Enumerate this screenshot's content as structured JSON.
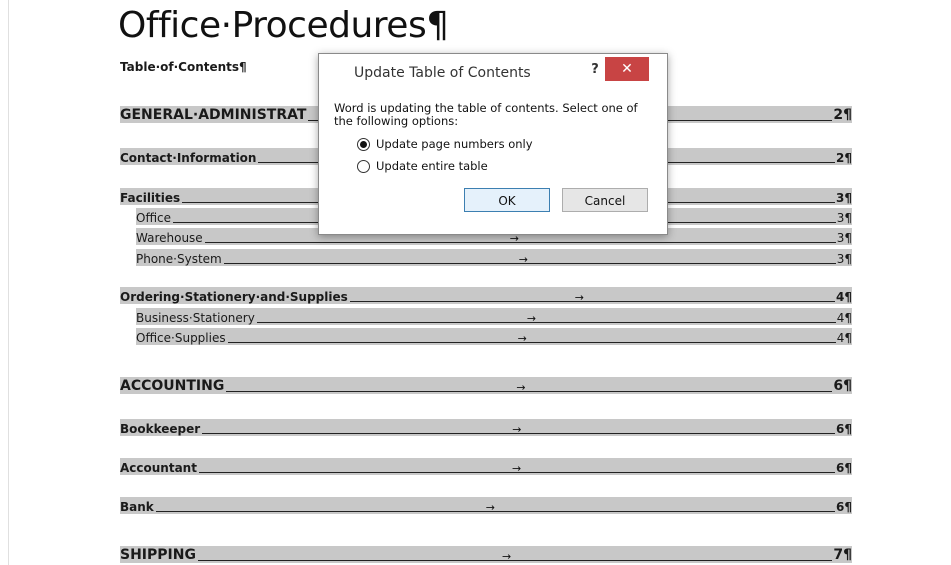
{
  "document": {
    "title": "Office·Procedures¶",
    "subtitle": "Table·of·Contents¶"
  },
  "toc": {
    "tab_arrow": "→",
    "entries": [
      {
        "label": "GENERAL·ADMINISTRAT",
        "page": "2¶"
      },
      {
        "label": "Contact·Information",
        "page": "2¶"
      },
      {
        "label": "Facilities",
        "page": "3¶"
      },
      {
        "label": "Office",
        "page": "3¶"
      },
      {
        "label": "Warehouse",
        "page": "3¶"
      },
      {
        "label": "Phone·System",
        "page": "3¶"
      },
      {
        "label": "Ordering·Stationery·and·Supplies",
        "page": "4¶"
      },
      {
        "label": "Business·Stationery",
        "page": "4¶"
      },
      {
        "label": "Office·Supplies",
        "page": "4¶"
      },
      {
        "label": "ACCOUNTING",
        "page": "6¶"
      },
      {
        "label": "Bookkeeper",
        "page": "6¶"
      },
      {
        "label": "Accountant",
        "page": "6¶"
      },
      {
        "label": "Bank",
        "page": "6¶"
      },
      {
        "label": "SHIPPING",
        "page": "7¶"
      }
    ]
  },
  "dialog": {
    "title": "Update Table of Contents",
    "help": "?",
    "close": "✕",
    "message": "Word is updating the table of contents.  Select one of the following options:",
    "option_page_numbers": "Update page numbers only",
    "option_entire_table": "Update entire table",
    "selected_option": "Update page numbers only",
    "ok_label": "OK",
    "cancel_label": "Cancel"
  },
  "colors": {
    "highlight": "#c8c8c8",
    "close_button": "#c84444",
    "ok_border": "#3c7fb1"
  }
}
